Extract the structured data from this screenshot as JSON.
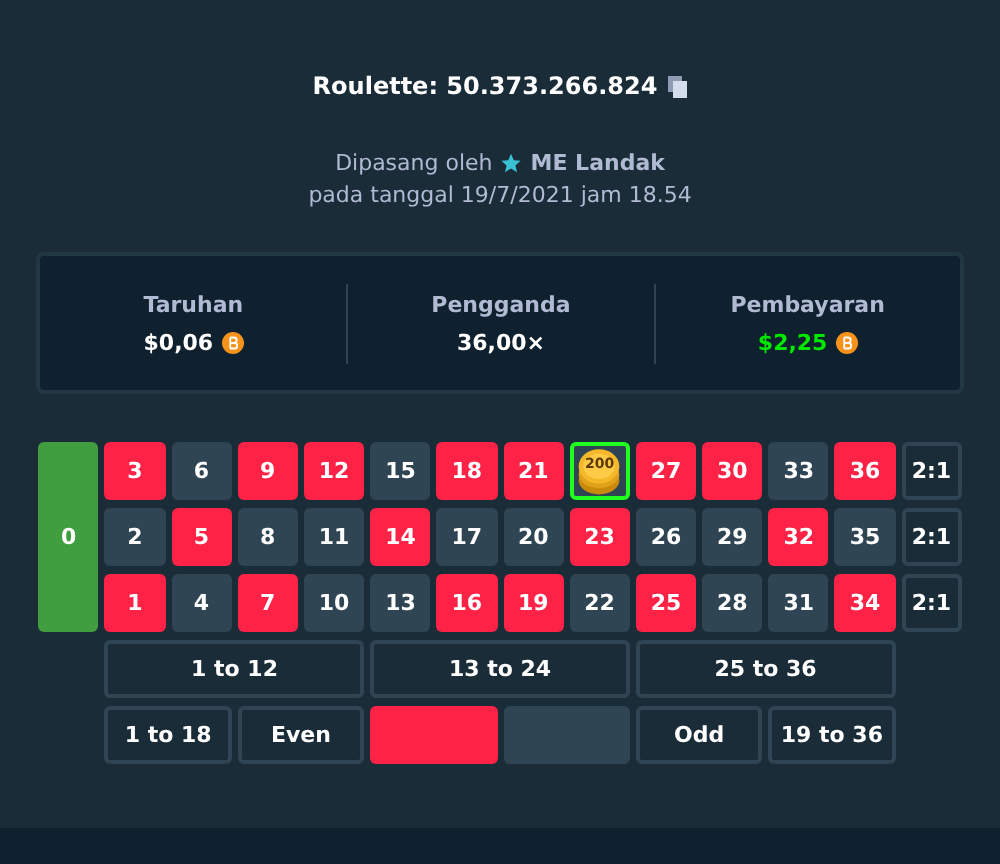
{
  "title": {
    "label": "Roulette: 50.373.266.824"
  },
  "placed_by": {
    "prefix": "Dipasang oleh",
    "user": "ME Landak",
    "date": "pada tanggal 19/7/2021 jam 18.54"
  },
  "stats": [
    {
      "label": "Taruhan",
      "value": "$0,06",
      "coin": true,
      "kind": "neutral"
    },
    {
      "label": "Pengganda",
      "value": "36,00×",
      "coin": false,
      "kind": "neutral"
    },
    {
      "label": "Pembayaran",
      "value": "$2,25",
      "coin": true,
      "kind": "win"
    }
  ],
  "board": {
    "zero": {
      "label": "0",
      "color": "#419e3f"
    },
    "rows": [
      [
        {
          "label": "3",
          "color": "#fe2247",
          "selected": false
        },
        {
          "label": "6",
          "color": "#2f4553",
          "selected": false
        },
        {
          "label": "9",
          "color": "#fe2247",
          "selected": false
        },
        {
          "label": "12",
          "color": "#fe2247",
          "selected": false
        },
        {
          "label": "15",
          "color": "#2f4553",
          "selected": false
        },
        {
          "label": "18",
          "color": "#fe2247",
          "selected": false
        },
        {
          "label": "21",
          "color": "#fe2247",
          "selected": false
        },
        {
          "chip": "200",
          "color": "#2f4553",
          "selected": true
        },
        {
          "label": "27",
          "color": "#fe2247",
          "selected": false
        },
        {
          "label": "30",
          "color": "#fe2247",
          "selected": false
        },
        {
          "label": "33",
          "color": "#2f4553",
          "selected": false
        },
        {
          "label": "36",
          "color": "#fe2247",
          "selected": false
        }
      ],
      [
        {
          "label": "2",
          "color": "#2f4553",
          "selected": false
        },
        {
          "label": "5",
          "color": "#fe2247",
          "selected": false
        },
        {
          "label": "8",
          "color": "#2f4553",
          "selected": false
        },
        {
          "label": "11",
          "color": "#2f4553",
          "selected": false
        },
        {
          "label": "14",
          "color": "#fe2247",
          "selected": false
        },
        {
          "label": "17",
          "color": "#2f4553",
          "selected": false
        },
        {
          "label": "20",
          "color": "#2f4553",
          "selected": false
        },
        {
          "label": "23",
          "color": "#fe2247",
          "selected": false
        },
        {
          "label": "26",
          "color": "#2f4553",
          "selected": false
        },
        {
          "label": "29",
          "color": "#2f4553",
          "selected": false
        },
        {
          "label": "32",
          "color": "#fe2247",
          "selected": false
        },
        {
          "label": "35",
          "color": "#2f4553",
          "selected": false
        }
      ],
      [
        {
          "label": "1",
          "color": "#fe2247",
          "selected": false
        },
        {
          "label": "4",
          "color": "#2f4553",
          "selected": false
        },
        {
          "label": "7",
          "color": "#fe2247",
          "selected": false
        },
        {
          "label": "10",
          "color": "#2f4553",
          "selected": false
        },
        {
          "label": "13",
          "color": "#2f4553",
          "selected": false
        },
        {
          "label": "16",
          "color": "#fe2247",
          "selected": false
        },
        {
          "label": "19",
          "color": "#fe2247",
          "selected": false
        },
        {
          "label": "22",
          "color": "#2f4553",
          "selected": false
        },
        {
          "label": "25",
          "color": "#fe2247",
          "selected": false
        },
        {
          "label": "28",
          "color": "#2f4553",
          "selected": false
        },
        {
          "label": "31",
          "color": "#2f4553",
          "selected": false
        },
        {
          "label": "34",
          "color": "#fe2247",
          "selected": false
        }
      ]
    ],
    "column_bets": [
      "2:1",
      "2:1",
      "2:1"
    ],
    "dozens": [
      "1 to 12",
      "13 to 24",
      "25 to 36"
    ],
    "outside": [
      {
        "kind": "label",
        "label": "1 to 18"
      },
      {
        "kind": "label",
        "label": "Even"
      },
      {
        "kind": "swatch",
        "color": "#fe2247"
      },
      {
        "kind": "swatch",
        "color": "#2f4553"
      },
      {
        "kind": "label",
        "label": "Odd"
      },
      {
        "kind": "label",
        "label": "19 to 36"
      }
    ]
  }
}
